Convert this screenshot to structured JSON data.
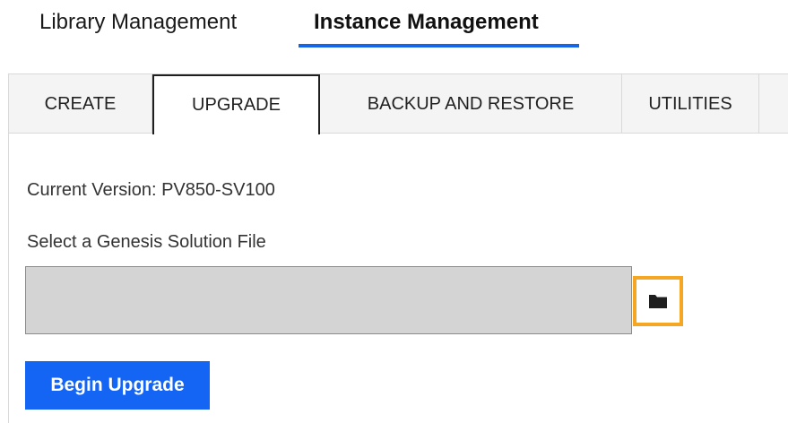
{
  "top_nav": {
    "items": [
      {
        "label": "Library Management",
        "active": false
      },
      {
        "label": "Instance Management",
        "active": true
      }
    ],
    "accent_color": "#1565e8"
  },
  "tabs": [
    {
      "label": "CREATE",
      "active": false
    },
    {
      "label": "UPGRADE",
      "active": true
    },
    {
      "label": "BACKUP AND RESTORE",
      "active": false
    },
    {
      "label": "UTILITIES",
      "active": false
    }
  ],
  "upgrade_panel": {
    "current_version_text": "Current Version: PV850-SV100",
    "file_label": "Select a Genesis Solution File",
    "file_value": "",
    "browse_icon": "folder-icon",
    "browse_highlight_color": "#f5a623",
    "begin_button_label": "Begin Upgrade",
    "begin_button_color": "#1565f5"
  }
}
